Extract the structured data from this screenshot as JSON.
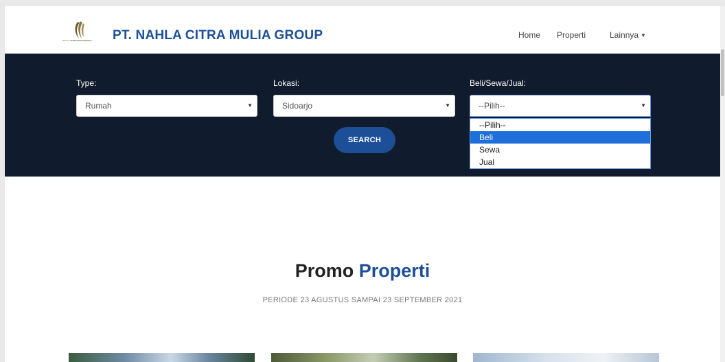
{
  "header": {
    "logo_caption": "NAHLA CITRA MULIA GROUP",
    "brand": "PT. NAHLA CITRA MULIA GROUP",
    "nav": {
      "home": "Home",
      "properti": "Properti",
      "lainnya": "Lainnya"
    }
  },
  "search": {
    "type": {
      "label": "Type:",
      "value": "Rumah"
    },
    "lokasi": {
      "label": "Lokasi:",
      "value": "Sidoarjo"
    },
    "beli": {
      "label": "Beli/Sewa/Jual:",
      "value": "--Pilih--",
      "options": [
        "--Pilih--",
        "Beli",
        "Sewa",
        "Jual"
      ],
      "highlighted": "Beli"
    },
    "button": "SEARCH"
  },
  "promo": {
    "title_part1": "Promo",
    "title_part2": "Properti",
    "subtitle": "PERIODE 23 AGUSTUS SAMPAI 23 SEPTEMBER 2021"
  },
  "colors": {
    "brand": "#1c4f97",
    "band": "#101b2d",
    "highlight": "#1e6fd9"
  },
  "icons": {
    "dropdown_arrow": "caret-down-icon",
    "logo": "company-logo"
  }
}
